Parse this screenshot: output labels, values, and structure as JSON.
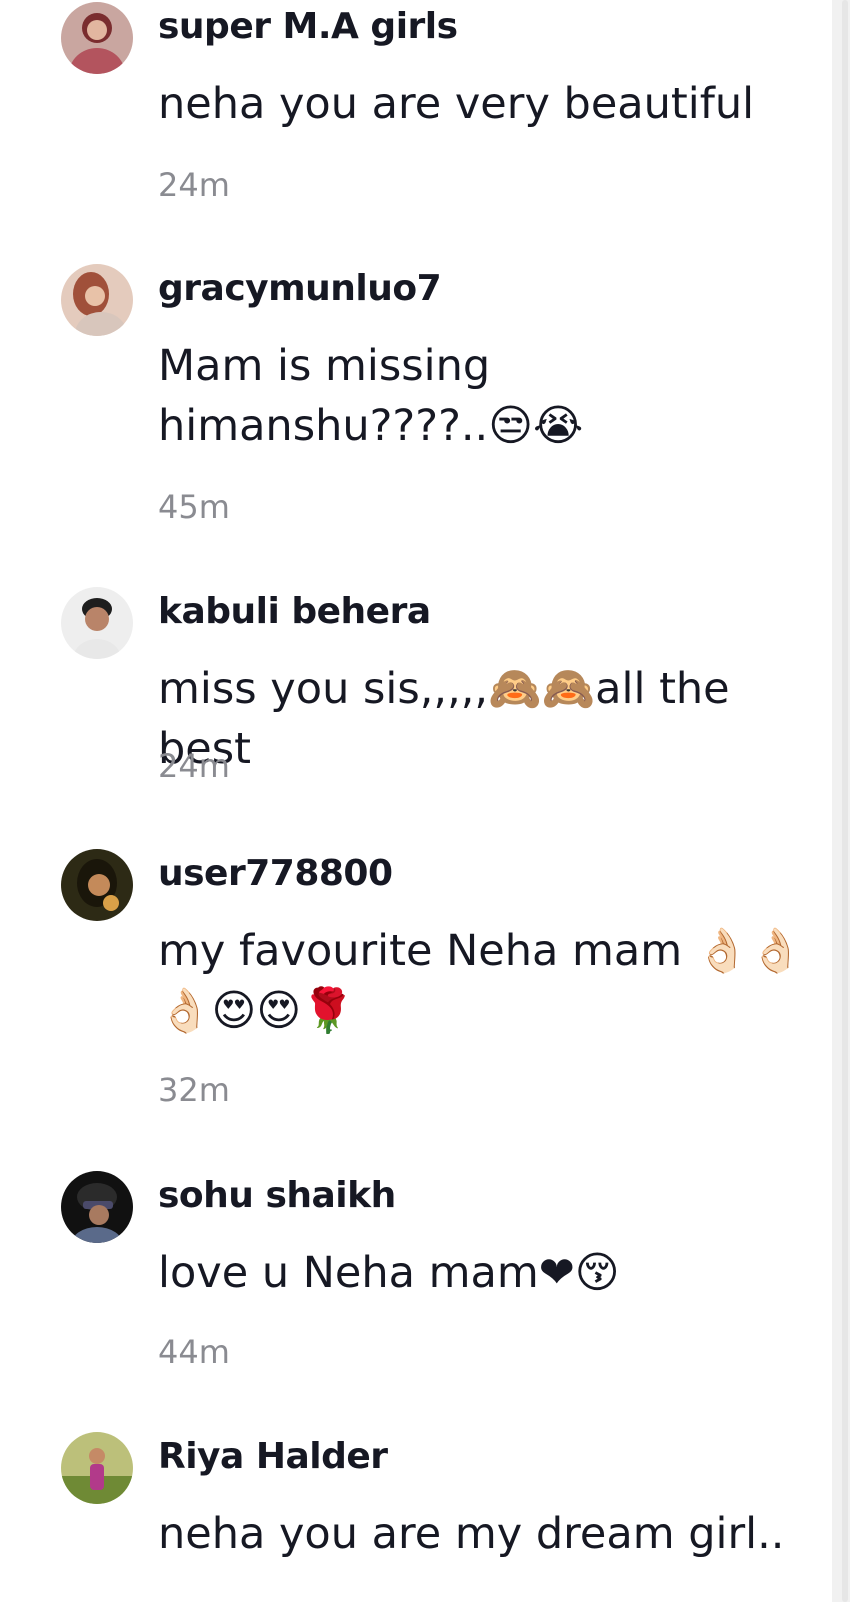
{
  "comments": [
    {
      "username": "super M.A girls",
      "text": "neha you are very beautiful",
      "time": "24m",
      "avatar_color": "#b3545e"
    },
    {
      "username": "gracymunluo7",
      "text": "Mam is missing himanshu????..😒😭",
      "time": "45m",
      "avatar_color": "#b97f66"
    },
    {
      "username": "kabuli behera",
      "text": "miss you sis,,,,,🙈🙈all the best",
      "time": "24m",
      "avatar_color": "#d9d9d9"
    },
    {
      "username": "user778800",
      "text": "my favourite Neha mam 👌🏻👌🏻👌🏻😍😍🌹",
      "time": "32m",
      "avatar_color": "#3a3520"
    },
    {
      "username": "sohu shaikh",
      "text": "love u Neha mam❤😚",
      "time": "44m",
      "avatar_color": "#222222"
    },
    {
      "username": "Riya Halder",
      "text": "neha you are my dream girl..",
      "time": "",
      "avatar_color": "#7a9a3e"
    }
  ]
}
